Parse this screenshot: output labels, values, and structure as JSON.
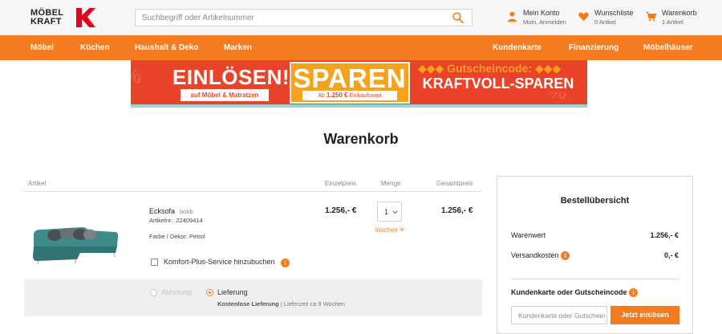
{
  "brand": {
    "logo_line1": "MÖBEL",
    "logo_line2": "KRAFT"
  },
  "search": {
    "placeholder": "Suchbegriff oder Artikelnummer"
  },
  "header": {
    "account": {
      "title": "Mein Konto",
      "subtitle": "Moin, Anmelden"
    },
    "wishlist": {
      "title": "Wunschliste",
      "subtitle": "0 Artikel"
    },
    "cart": {
      "title": "Warenkorb",
      "subtitle": "1 Artikel"
    }
  },
  "nav": {
    "left": [
      "Möbel",
      "Küchen",
      "Haushalt & Deko",
      "Marken"
    ],
    "right": [
      "Kundenkarte",
      "Finanzierung",
      "Möbelhäuser"
    ]
  },
  "banner": {
    "headline": "EINLÖSEN!",
    "sub": "auf Möbel & Matratzen",
    "box_title": "SPAREN",
    "box_sub_prefix": "Ab",
    "box_sub_amount": "1.250 €",
    "box_sub_suffix": "Einkaufswert",
    "code_label": "◆◆◆ Gutscheincode: ◆◆◆",
    "code": "KRAFTVOLL-SPAREN"
  },
  "page": {
    "title": "Warenkorb"
  },
  "table": {
    "headers": {
      "article": "Artikel",
      "unit_price": "Einzelpreis",
      "quantity": "Menge",
      "total": "Gesamtpreis"
    }
  },
  "item": {
    "name": "Ecksofa",
    "brand": "bobb",
    "article_no": "Artikelnr.: 22409414",
    "color": "Farbe / Dekor: Petrol",
    "unit_price": "1.256,- €",
    "quantity": "1",
    "total": "1.256,- €",
    "remove_label": "löschen ✕",
    "service_label": "Komfort-Plus-Service hinzubuchen"
  },
  "delivery": {
    "pickup_label": "Abholung",
    "delivery_label": "Lieferung",
    "delivery_note_bold": "Kostenlose Lieferung",
    "delivery_note_rest": " | Lieferzeit ca 9 Wochen"
  },
  "summary": {
    "title": "Bestellübersicht",
    "goods_label": "Warenwert",
    "goods_value": "1.256,- €",
    "shipping_label": "Versandkosten",
    "shipping_value": "0,- €",
    "coupon_label": "Kundenkarte oder Gutscheincode",
    "coupon_placeholder": "Kundenkarte oder Gutschein",
    "coupon_button": "Jetzt einlösen"
  },
  "colors": {
    "accent": "#f47b20",
    "brand_red": "#e2001a",
    "banner_red": "#e9442a",
    "sofa": "#3f8a8a"
  }
}
